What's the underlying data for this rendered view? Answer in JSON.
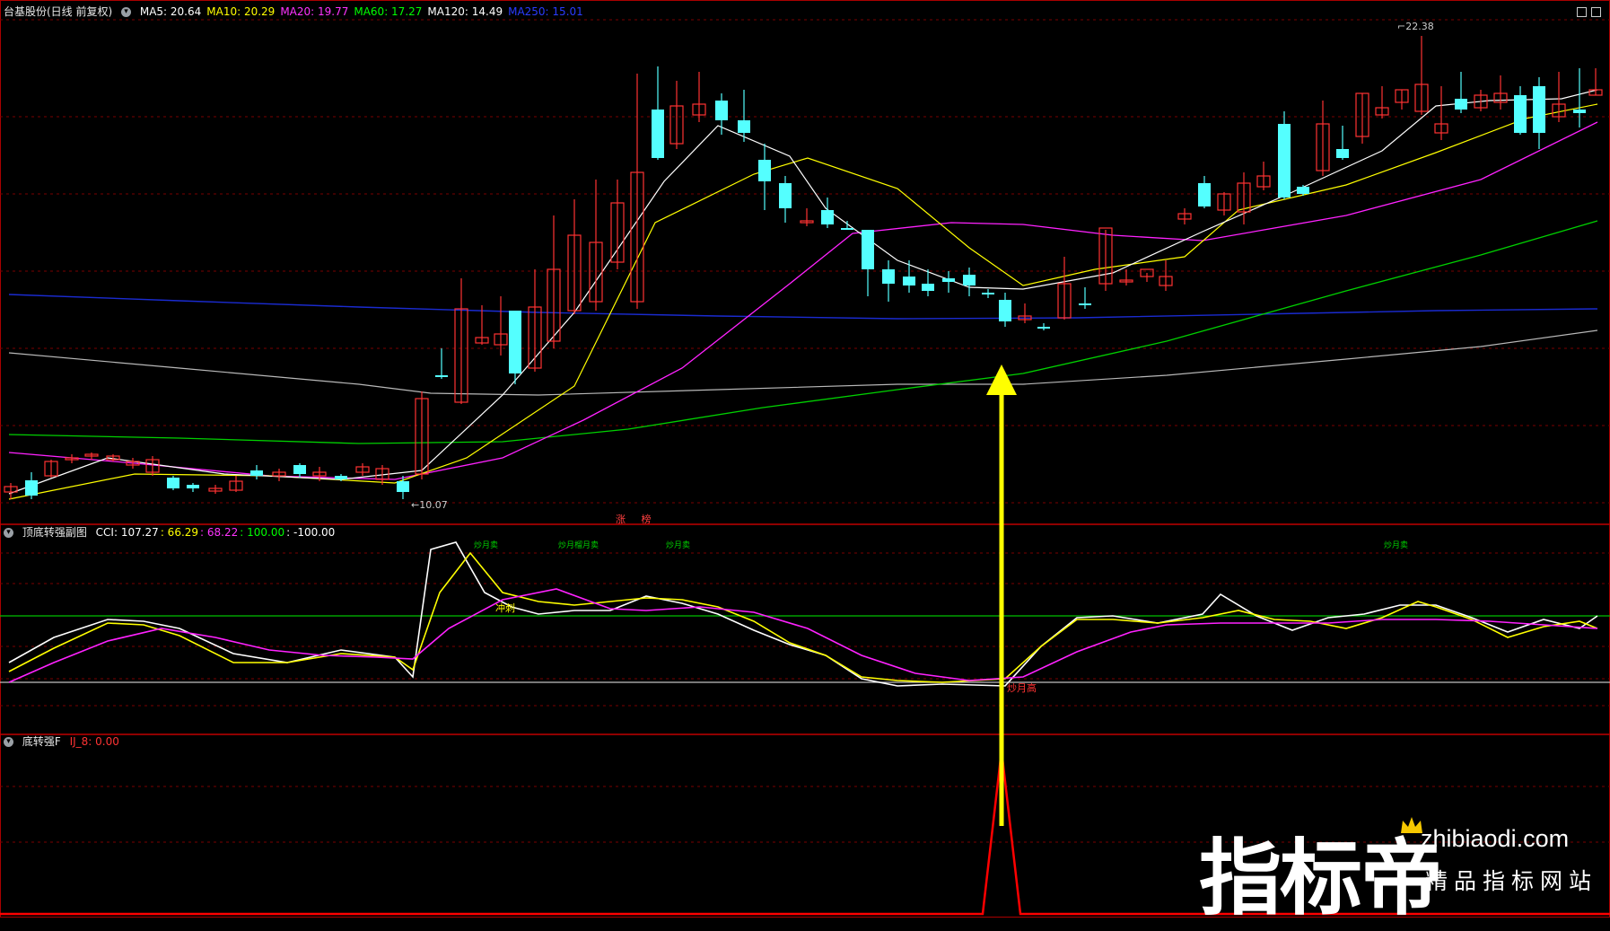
{
  "colors": {
    "bg": "#000000",
    "up": "#ff3333",
    "down": "#54ffff",
    "ma5": "#ffffff",
    "ma10": "#ffff00",
    "ma20": "#ff00ff",
    "ma60": "#00ff00",
    "ma120": "#c0c0c0",
    "ma250": "#0000ff",
    "grid": "#7a0000",
    "arrow": "#ffff00",
    "signal": "#ff0000"
  },
  "main_panel": {
    "title": "台基股份(日线 前复权)",
    "indicators": [
      {
        "label": "MA5: 20.64",
        "color": "#ffffff"
      },
      {
        "label": "MA10: 20.29",
        "color": "#ffff00"
      },
      {
        "label": "MA20: 19.77",
        "color": "#ff33ff"
      },
      {
        "label": "MA60: 17.27",
        "color": "#00ff00"
      },
      {
        "label": "MA120: 14.49",
        "color": "#ffffff"
      },
      {
        "label": "MA250: 15.01",
        "color": "#2a3cff"
      }
    ],
    "high_label": "22.38",
    "low_label": "10.07",
    "event_label": "涨",
    "event_label_2": "榜"
  },
  "cci_panel": {
    "title": "顶底转强副图",
    "values": [
      {
        "label": "CCI: 107.27",
        "color": "#ffffff"
      },
      {
        "label": ": 66.29",
        "color": "#ffff00"
      },
      {
        "label": ": 68.22",
        "color": "#ff33ff"
      },
      {
        "label": ": 100.00",
        "color": "#00ff00"
      },
      {
        "label": ": -100.00",
        "color": "#ffffff"
      }
    ],
    "markers": [
      {
        "text": "炒月卖",
        "color": "#00cc00"
      },
      {
        "text": "炒月榴月卖",
        "color": "#00cc00"
      },
      {
        "text": "炒月卖",
        "color": "#00cc00"
      },
      {
        "text": "炒月卖",
        "color": "#00cc00"
      },
      {
        "text": "冲刺",
        "color": "#ffff00"
      },
      {
        "text": "炒月高",
        "color": "#ff3333"
      }
    ]
  },
  "signal_panel": {
    "title": "底转强F",
    "value_label": "IJ_8: 0.00"
  },
  "watermark": {
    "brand": "指标帝",
    "site": "zhibiaodi.com",
    "tagline": "精品指标网站"
  }
}
